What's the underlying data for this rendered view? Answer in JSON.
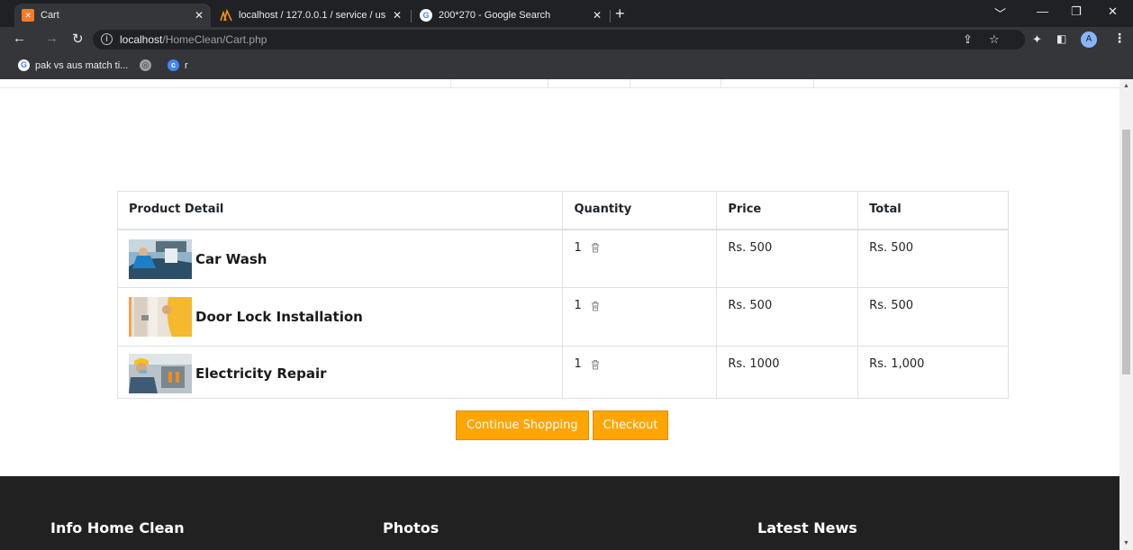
{
  "browser": {
    "tabs": [
      {
        "title": "Cart",
        "active": true
      },
      {
        "title": "localhost / 127.0.0.1 / service / us",
        "active": false
      },
      {
        "title": "200*270 - Google Search",
        "active": false
      }
    ],
    "url": {
      "host": "localhost",
      "path": "/HomeClean/Cart.php"
    },
    "bookmarks": [
      {
        "label": "pak vs aus match ti..."
      },
      {
        "label": ""
      },
      {
        "label": "r"
      }
    ],
    "profile_initial": "A"
  },
  "cart": {
    "headers": {
      "product": "Product Detail",
      "quantity": "Quantity",
      "price": "Price",
      "total": "Total"
    },
    "rows": [
      {
        "name": "Car Wash",
        "quantity": "1",
        "price": "Rs. 500",
        "total": "Rs. 500",
        "thumb": "car-wash-thumbnail"
      },
      {
        "name": "Door Lock Installation",
        "quantity": "1",
        "price": "Rs. 500",
        "total": "Rs. 500",
        "thumb": "door-lock-thumbnail"
      },
      {
        "name": "Electricity Repair",
        "quantity": "1",
        "price": "Rs. 1000",
        "total": "Rs. 1,000",
        "thumb": "electricity-repair-thumbnail"
      }
    ],
    "buttons": {
      "continue": "Continue Shopping",
      "checkout": "Checkout"
    }
  },
  "footer": {
    "headings": [
      "Info Home Clean",
      "Photos",
      "Latest News"
    ]
  },
  "colors": {
    "accent": "#ffa500",
    "footer_bg": "#212121",
    "chrome_dark": "#202124",
    "chrome_toolbar": "#35363a"
  }
}
